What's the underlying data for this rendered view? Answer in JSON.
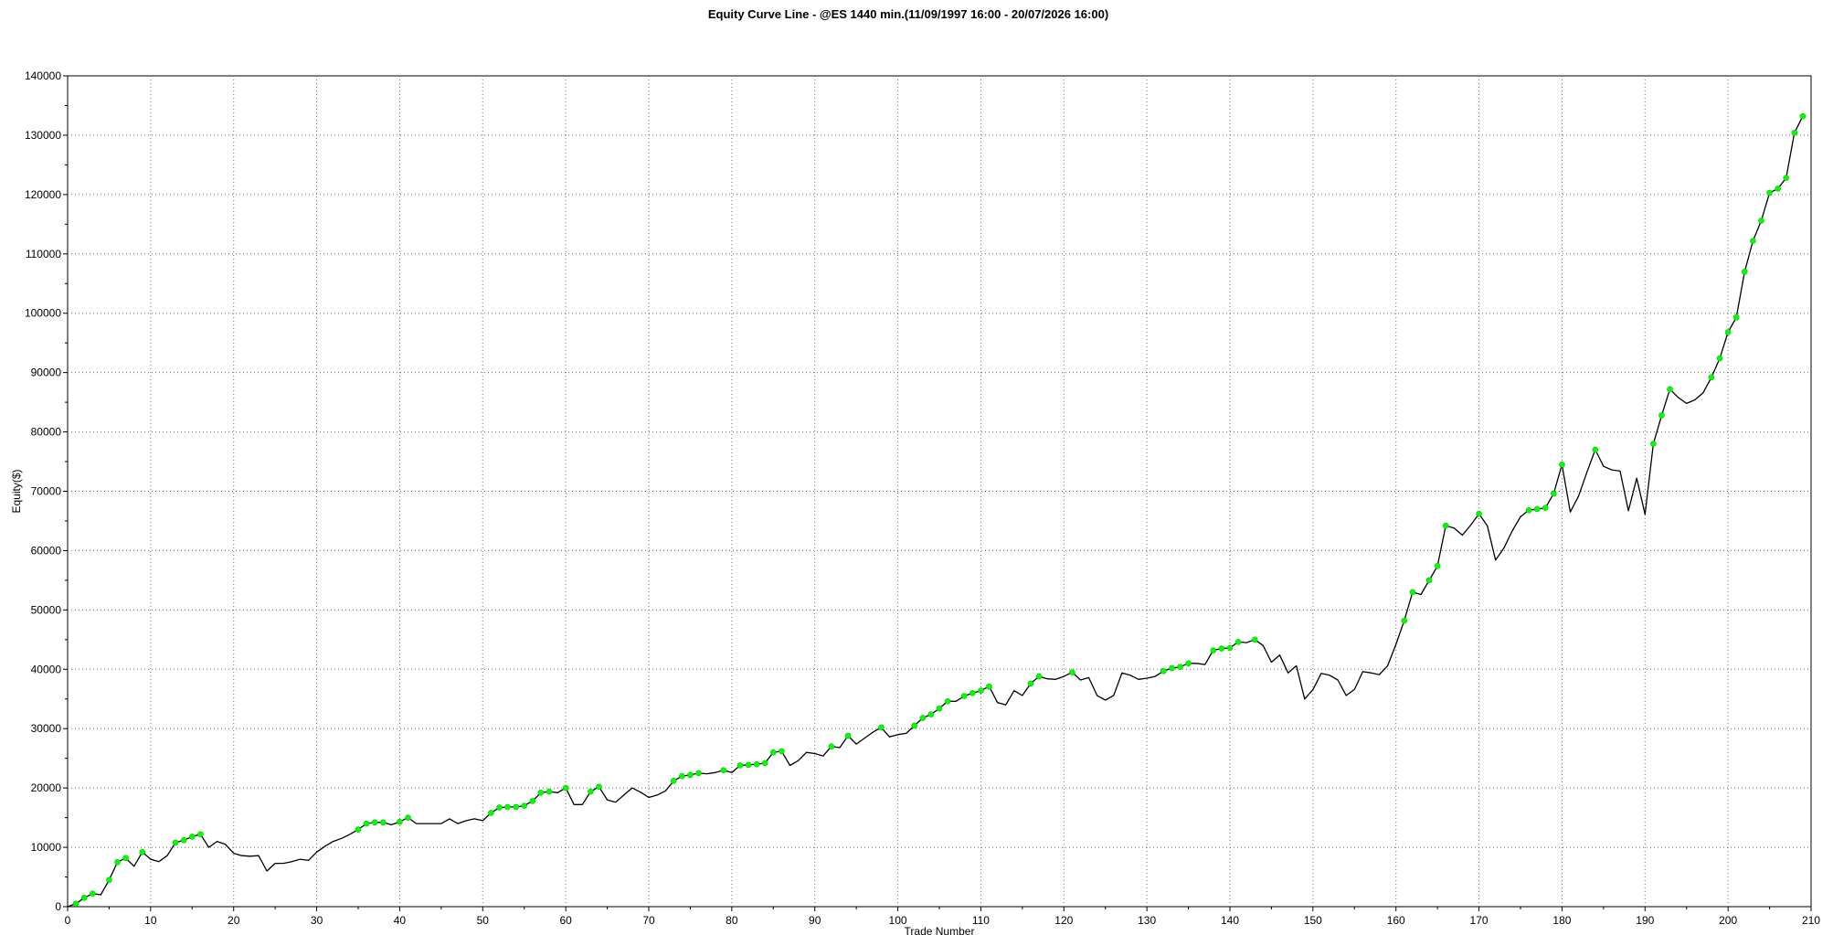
{
  "chart_data": {
    "type": "line",
    "title": "Equity Curve Line - @ES 1440 min.(11/09/1997 16:00 - 20/07/2026 16:00)",
    "xlabel": "Trade Number",
    "ylabel": "Equity($)",
    "xlim": [
      0,
      210
    ],
    "ylim": [
      0,
      140000
    ],
    "x_ticks": [
      0,
      10,
      20,
      30,
      40,
      50,
      60,
      70,
      80,
      90,
      100,
      110,
      120,
      130,
      140,
      150,
      160,
      170,
      180,
      190,
      200,
      210
    ],
    "y_ticks": [
      0,
      10000,
      20000,
      30000,
      40000,
      50000,
      60000,
      70000,
      80000,
      90000,
      100000,
      110000,
      120000,
      130000,
      140000
    ],
    "grid": true,
    "colors": {
      "line": "#000000",
      "marker": "#00ff00",
      "grid": "#6e6e6e"
    },
    "series": [
      {
        "values": [
          [
            0,
            0
          ],
          [
            1,
            500
          ],
          [
            2,
            1500
          ],
          [
            3,
            2200
          ],
          [
            4,
            2000
          ],
          [
            5,
            4500
          ],
          [
            6,
            7500
          ],
          [
            7,
            8200
          ],
          [
            8,
            6800
          ],
          [
            9,
            9200
          ],
          [
            10,
            8000
          ],
          [
            11,
            7600
          ],
          [
            12,
            8600
          ],
          [
            13,
            10800
          ],
          [
            14,
            11200
          ],
          [
            15,
            11800
          ],
          [
            16,
            12200
          ],
          [
            17,
            10000
          ],
          [
            18,
            11000
          ],
          [
            19,
            10500
          ],
          [
            20,
            9000
          ],
          [
            21,
            8600
          ],
          [
            22,
            8500
          ],
          [
            23,
            8600
          ],
          [
            24,
            6000
          ],
          [
            25,
            7300
          ],
          [
            26,
            7300
          ],
          [
            27,
            7600
          ],
          [
            28,
            8000
          ],
          [
            29,
            7800
          ],
          [
            30,
            9200
          ],
          [
            31,
            10200
          ],
          [
            32,
            11000
          ],
          [
            33,
            11500
          ],
          [
            34,
            12200
          ],
          [
            35,
            13000
          ],
          [
            36,
            14000
          ],
          [
            37,
            14200
          ],
          [
            38,
            14200
          ],
          [
            39,
            13800
          ],
          [
            40,
            14300
          ],
          [
            41,
            15000
          ],
          [
            42,
            14000
          ],
          [
            43,
            14000
          ],
          [
            44,
            14000
          ],
          [
            45,
            14000
          ],
          [
            46,
            14800
          ],
          [
            47,
            14000
          ],
          [
            48,
            14500
          ],
          [
            49,
            14800
          ],
          [
            50,
            14500
          ],
          [
            51,
            15800
          ],
          [
            52,
            16700
          ],
          [
            53,
            16800
          ],
          [
            54,
            16800
          ],
          [
            55,
            17000
          ],
          [
            56,
            17800
          ],
          [
            57,
            19200
          ],
          [
            58,
            19400
          ],
          [
            59,
            19200
          ],
          [
            60,
            20000
          ],
          [
            61,
            17200
          ],
          [
            62,
            17200
          ],
          [
            63,
            19400
          ],
          [
            64,
            20200
          ],
          [
            65,
            18000
          ],
          [
            66,
            17600
          ],
          [
            67,
            18800
          ],
          [
            68,
            20000
          ],
          [
            69,
            19300
          ],
          [
            70,
            18400
          ],
          [
            71,
            18800
          ],
          [
            72,
            19500
          ],
          [
            73,
            21200
          ],
          [
            74,
            22000
          ],
          [
            75,
            22200
          ],
          [
            76,
            22500
          ],
          [
            77,
            22400
          ],
          [
            78,
            22600
          ],
          [
            79,
            23000
          ],
          [
            80,
            22600
          ],
          [
            81,
            23800
          ],
          [
            82,
            23900
          ],
          [
            83,
            24000
          ],
          [
            84,
            24200
          ],
          [
            85,
            26000
          ],
          [
            86,
            26200
          ],
          [
            87,
            23800
          ],
          [
            88,
            24600
          ],
          [
            89,
            26000
          ],
          [
            90,
            25800
          ],
          [
            91,
            25400
          ],
          [
            92,
            27000
          ],
          [
            93,
            26800
          ],
          [
            94,
            28800
          ],
          [
            95,
            27400
          ],
          [
            96,
            28400
          ],
          [
            97,
            29400
          ],
          [
            98,
            30200
          ],
          [
            99,
            28600
          ],
          [
            100,
            29000
          ],
          [
            101,
            29200
          ],
          [
            102,
            30500
          ],
          [
            103,
            31800
          ],
          [
            104,
            32400
          ],
          [
            105,
            33400
          ],
          [
            106,
            34600
          ],
          [
            107,
            34600
          ],
          [
            108,
            35500
          ],
          [
            109,
            36000
          ],
          [
            110,
            36400
          ],
          [
            111,
            37100
          ],
          [
            112,
            34400
          ],
          [
            113,
            34000
          ],
          [
            114,
            36400
          ],
          [
            115,
            35600
          ],
          [
            116,
            37600
          ],
          [
            117,
            38800
          ],
          [
            118,
            38400
          ],
          [
            119,
            38300
          ],
          [
            120,
            38800
          ],
          [
            121,
            39500
          ],
          [
            122,
            38200
          ],
          [
            123,
            38600
          ],
          [
            124,
            35600
          ],
          [
            125,
            34800
          ],
          [
            126,
            35600
          ],
          [
            127,
            39400
          ],
          [
            128,
            39000
          ],
          [
            129,
            38300
          ],
          [
            130,
            38500
          ],
          [
            131,
            38800
          ],
          [
            132,
            39700
          ],
          [
            133,
            40200
          ],
          [
            134,
            40400
          ],
          [
            135,
            41000
          ],
          [
            136,
            41000
          ],
          [
            137,
            40800
          ],
          [
            138,
            43200
          ],
          [
            139,
            43500
          ],
          [
            140,
            43600
          ],
          [
            141,
            44600
          ],
          [
            142,
            44500
          ],
          [
            143,
            45000
          ],
          [
            144,
            44000
          ],
          [
            145,
            41200
          ],
          [
            146,
            42400
          ],
          [
            147,
            39400
          ],
          [
            148,
            40600
          ],
          [
            149,
            35000
          ],
          [
            150,
            36600
          ],
          [
            151,
            39300
          ],
          [
            152,
            39000
          ],
          [
            153,
            38200
          ],
          [
            154,
            35600
          ],
          [
            155,
            36600
          ],
          [
            156,
            39600
          ],
          [
            157,
            39400
          ],
          [
            158,
            39100
          ],
          [
            159,
            40600
          ],
          [
            160,
            44200
          ],
          [
            161,
            48200
          ],
          [
            162,
            53000
          ],
          [
            163,
            52600
          ],
          [
            164,
            55000
          ],
          [
            165,
            57400
          ],
          [
            166,
            64200
          ],
          [
            167,
            63800
          ],
          [
            168,
            62600
          ],
          [
            169,
            64300
          ],
          [
            170,
            66200
          ],
          [
            171,
            64200
          ],
          [
            172,
            58400
          ],
          [
            173,
            60400
          ],
          [
            174,
            63300
          ],
          [
            175,
            65700
          ],
          [
            176,
            66800
          ],
          [
            177,
            67000
          ],
          [
            178,
            67200
          ],
          [
            179,
            69600
          ],
          [
            180,
            74500
          ],
          [
            181,
            66500
          ],
          [
            182,
            69200
          ],
          [
            183,
            73200
          ],
          [
            184,
            77000
          ],
          [
            185,
            74200
          ],
          [
            186,
            73600
          ],
          [
            187,
            73400
          ],
          [
            188,
            66700
          ],
          [
            189,
            72200
          ],
          [
            190,
            66100
          ],
          [
            191,
            78000
          ],
          [
            192,
            82800
          ],
          [
            193,
            87200
          ],
          [
            194,
            85800
          ],
          [
            195,
            84800
          ],
          [
            196,
            85400
          ],
          [
            197,
            86600
          ],
          [
            198,
            89200
          ],
          [
            199,
            92400
          ],
          [
            200,
            96800
          ],
          [
            201,
            99300
          ],
          [
            202,
            107000
          ],
          [
            203,
            112200
          ],
          [
            204,
            115600
          ],
          [
            205,
            120300
          ],
          [
            206,
            121000
          ],
          [
            207,
            122800
          ],
          [
            208,
            130400
          ],
          [
            209,
            133200
          ]
        ],
        "markers": [
          1,
          2,
          3,
          5,
          6,
          7,
          9,
          13,
          14,
          15,
          16,
          35,
          36,
          37,
          38,
          40,
          41,
          51,
          52,
          53,
          54,
          55,
          56,
          57,
          58,
          60,
          63,
          64,
          73,
          74,
          75,
          76,
          79,
          81,
          82,
          83,
          84,
          85,
          86,
          92,
          94,
          98,
          102,
          103,
          104,
          105,
          106,
          108,
          109,
          110,
          111,
          116,
          117,
          121,
          132,
          133,
          134,
          135,
          138,
          139,
          140,
          141,
          143,
          161,
          162,
          164,
          165,
          166,
          170,
          176,
          177,
          178,
          179,
          180,
          184,
          191,
          192,
          193,
          198,
          199,
          200,
          201,
          202,
          203,
          204,
          205,
          206,
          207,
          208,
          209
        ]
      }
    ]
  }
}
